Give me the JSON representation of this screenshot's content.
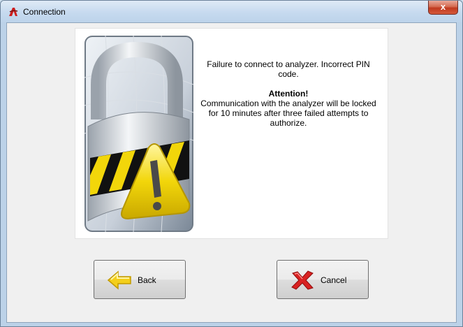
{
  "window": {
    "title": "Connection",
    "close_label": "x"
  },
  "message": {
    "line1": "Failure to connect to analyzer. Incorrect PIN code.",
    "attention": "Attention!",
    "line2": "Communication with the analyzer will be locked for 10 minutes after three failed attempts to authorize."
  },
  "buttons": {
    "back": "Back",
    "cancel": "Cancel"
  },
  "icons": {
    "app": "app-logo-icon",
    "illustration": "padlock-warning-icon",
    "back": "yellow-arrow-left-icon",
    "cancel": "red-x-icon"
  },
  "colors": {
    "warning_yellow": "#f2d60a",
    "cancel_red": "#d92222"
  }
}
